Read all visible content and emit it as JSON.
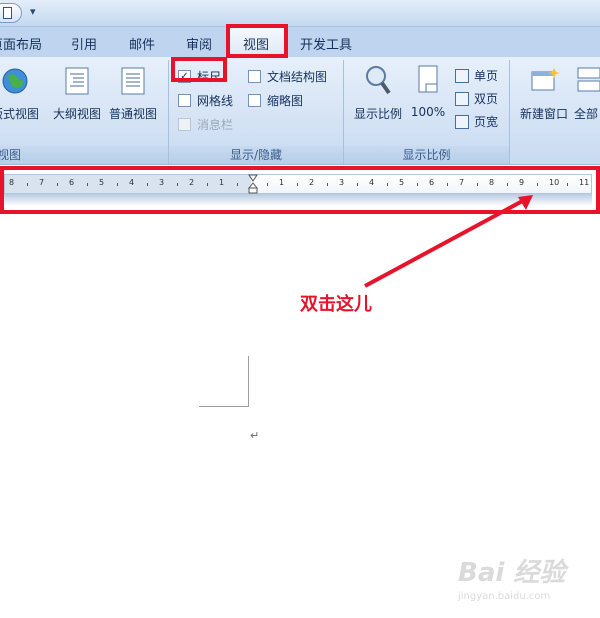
{
  "tabs": [
    "页面布局",
    "引用",
    "邮件",
    "审阅",
    "视图",
    "开发工具"
  ],
  "tabs_visible": [
    "页面布局",
    "引用",
    "邮件",
    "审阅",
    "视图",
    "开发工具"
  ],
  "ribbon": {
    "doc_views": {
      "label": "视图",
      "buttons": [
        "版式视图",
        "大纲视图",
        "普通视图"
      ]
    },
    "show_hide": {
      "label": "显示/隐藏",
      "ruler": "标尺",
      "gridlines": "网格线",
      "message_bar": "消息栏",
      "doc_map": "文档结构图",
      "thumbnails": "缩略图"
    },
    "zoom": {
      "label": "显示比例",
      "zoom_btn": "显示比例",
      "hundred": "100%",
      "one_page": "单页",
      "two_pages": "双页",
      "page_width": "页宽"
    },
    "window": {
      "new_window": "新建窗口",
      "arrange_all": "全部"
    }
  },
  "ruler": {
    "left_numbers": [
      "8",
      "7",
      "6",
      "5",
      "4",
      "3",
      "2",
      "1"
    ],
    "right_numbers": [
      "1",
      "2",
      "3",
      "4",
      "5",
      "6",
      "7",
      "8",
      "9",
      "10",
      "11"
    ]
  },
  "annotation": "双击这儿",
  "paragraph_mark": "↵",
  "watermark": {
    "logo": "Bai 经验",
    "url": "jingyan.baidu.com"
  },
  "colors": {
    "annotation_red": "#e8132b",
    "ribbon_bg": "#d6e4f5"
  }
}
